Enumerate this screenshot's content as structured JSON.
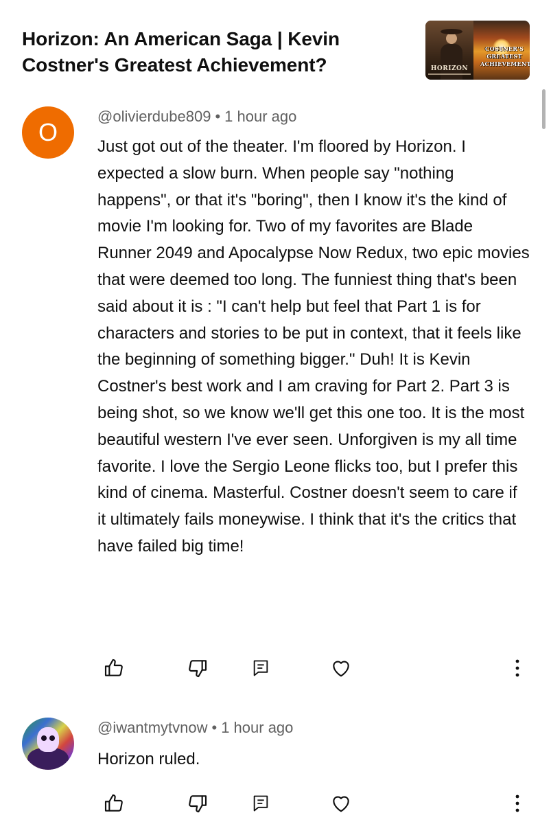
{
  "video": {
    "title": "Horizon: An American Saga | Kevin Costner's Greatest Achievement?",
    "thumbnail": {
      "left_title": "HORIZON",
      "caption": "COSTNER'S GREATEST ACHIEVEMENT?"
    }
  },
  "comments": [
    {
      "avatar_letter": "O",
      "avatar_color": "#ef6c00",
      "author": "@olivierdube809",
      "separator": "•",
      "time": "1 hour ago",
      "text": "Just got out of the theater.  I'm floored by Horizon.  I expected a slow burn.  When people say \"nothing happens\", or that it's \"boring\", then I know it's the kind of movie I'm looking for.  Two of my favorites are Blade Runner 2049 and Apocalypse Now Redux, two epic movies that were deemed too long.  The funniest thing that's been said about it is : \"I can't help but feel that Part 1 is for characters and stories to be put in context, that it feels like the beginning of something bigger.\"  Duh!  It is Kevin Costner's best work and I am craving for Part 2.  Part 3 is being shot, so we know we'll get this one too.  It is the most beautiful western I've ever seen. Unforgiven is my all time favorite.  I love the Sergio Leone flicks too, but I prefer this kind of cinema.  Masterful.  Costner doesn't seem to care if it ultimately fails moneywise.  I think that it's the critics that have failed big time!"
    },
    {
      "avatar_letter": "",
      "author": "@iwantmytvnow",
      "separator": "•",
      "time": "1 hour ago",
      "text": "Horizon ruled."
    }
  ],
  "icons": {
    "like": "thumbs-up-icon",
    "dislike": "thumbs-down-icon",
    "reply": "reply-icon",
    "heart": "heart-icon",
    "more": "more-vertical-icon"
  }
}
